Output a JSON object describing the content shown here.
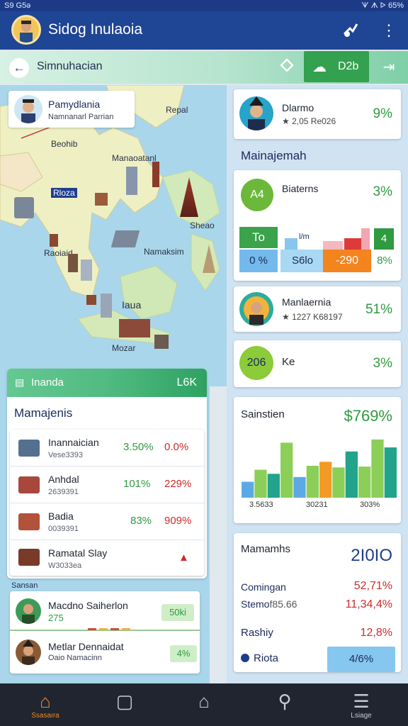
{
  "status": {
    "left": "S9 G5ə",
    "right": "ᗐ ᗑ ᐅ 65%"
  },
  "app": {
    "title": "Sidog Inulaoia"
  },
  "subheader": {
    "title": "Simnuhacian",
    "pill_value": "D2b"
  },
  "map": {
    "card_title": "Pamydlania",
    "card_subtitle": "Namnanarl Parrian",
    "labels": {
      "top_right": "Repal",
      "l1": "Beohib",
      "l2": "Manaoatanl",
      "l3": "Rloza",
      "l4": "Sheao",
      "l5": "Raoiaid",
      "l6": "Namaksim",
      "l7": "Iaua",
      "l8": "Mozar"
    }
  },
  "panel": {
    "header_label": "Inanda",
    "header_value": "L6K",
    "section_title": "Mamajenis",
    "rows": [
      {
        "name": "Inannaician",
        "sub": "Vese3393",
        "v1": "3.50%",
        "v2": "0.0%"
      },
      {
        "name": "Anhdal",
        "sub": "2639391",
        "v1": "101%",
        "v2": "229%"
      },
      {
        "name": "Badia",
        "sub": "0039391",
        "v1": "83%",
        "v2": "909%"
      },
      {
        "name": "Ramatal Slay",
        "sub": "W3033ea",
        "v1": "",
        "v2": "▲"
      }
    ],
    "small_label": "Sansan",
    "people": [
      {
        "name": "Macdno Saiherlon",
        "sub": "275",
        "badge": "50ki"
      },
      {
        "name": "Metlar Dennaidat",
        "sub": "Oaio Namacinn",
        "badge": "4%"
      }
    ]
  },
  "right": {
    "profile": {
      "name": "Dlarmo",
      "rating": "★ 2,05 Re026",
      "pct": "9%"
    },
    "section_title": "Mainajemah",
    "stats_card": {
      "label": "Biaterns",
      "circle": "A4",
      "pct": "3%"
    },
    "mini": [
      {
        "label": "To",
        "sub": "0 %"
      },
      {
        "label": "l/m",
        "sub": "S6lo"
      },
      {
        "label": "",
        "sub": "-290"
      },
      {
        "label": "4",
        "sub": "8%"
      }
    ],
    "card2": {
      "name": "Manlaernia",
      "rating": "★ 1227 K68197",
      "pct": "51%"
    },
    "card3": {
      "circle": "206",
      "label": "Ke",
      "pct": "3%"
    },
    "chart_title": "Sainstien",
    "chart_value": "$769%",
    "x_labels": [
      "3.5633",
      "30231",
      "303%"
    ],
    "summary": {
      "title": "Mamamhs",
      "value": "2I0IO",
      "r1_label": "Comingan",
      "r1_value": "52,71%",
      "r2_label": "Stemo",
      "r2_mid": "f85.66",
      "r2_value": "11,34,4%",
      "r3_label": "Rashiy",
      "r3_value": "12,8%",
      "r4_label": "Riota",
      "r4_value": "4/6%"
    }
  },
  "chart_data": {
    "type": "bar",
    "title": "Sainstien",
    "categories": [
      "1",
      "2",
      "3",
      "4",
      "5",
      "6",
      "7",
      "8",
      "9",
      "10",
      "11",
      "12"
    ],
    "values": [
      2.0,
      3.5,
      3.0,
      6.9,
      2.6,
      4.0,
      4.5,
      3.8,
      5.8,
      3.9,
      7.3,
      6.3
    ],
    "colors": [
      "#5da9e6",
      "#8ccf58",
      "#22a38b",
      "#8ccf58",
      "#5da9e6",
      "#8ccf58",
      "#f39a25",
      "#8ccf58",
      "#22a38b",
      "#8ccf58",
      "#8ccf58",
      "#22a38b"
    ],
    "ylim": [
      0,
      8
    ]
  },
  "nav": [
    {
      "label": "Ssasaıra"
    },
    {
      "label": ""
    },
    {
      "label": ""
    },
    {
      "label": ""
    },
    {
      "label": "Lsiage"
    }
  ]
}
